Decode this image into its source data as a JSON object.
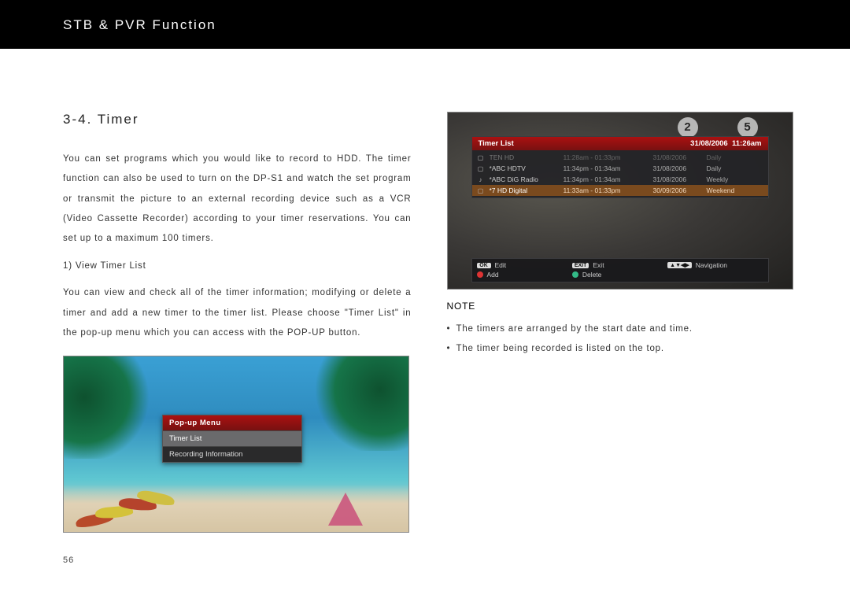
{
  "header": {
    "title": "STB & PVR Function"
  },
  "section": {
    "number": "3-4. Timer"
  },
  "left": {
    "p1": "You can set programs which you would like to record to HDD. The timer function can also be used to turn on the DP-S1 and watch the set program or transmit the picture to an external recording device such as a VCR (Video Cassette Recorder) according to your timer reservations. You can set up to a maximum 100 timers.",
    "sub1": "1) View Timer List",
    "p2": "You can view and check all of the timer information; modifying or delete a timer and add a new timer to the timer list. Please choose \"Timer List\" in the pop-up menu which you can access with the POP-UP button."
  },
  "popup": {
    "title": "Pop-up Menu",
    "items": [
      "Timer List",
      "Recording Information"
    ]
  },
  "timer": {
    "title": "Timer List",
    "datetime_date": "31/08/2006",
    "datetime_time": "11:26am",
    "rows": [
      {
        "icon": "tv",
        "name": "TEN HD",
        "time": "11:28am - 01:33pm",
        "date": "31/08/2006",
        "repeat": "Daily"
      },
      {
        "icon": "tv",
        "name": "*ABC HDTV",
        "time": "11:34pm - 01:34am",
        "date": "31/08/2006",
        "repeat": "Daily"
      },
      {
        "icon": "radio",
        "name": "*ABC DiG Radio",
        "time": "11:34pm - 01:34am",
        "date": "31/08/2006",
        "repeat": "Weekly"
      },
      {
        "icon": "tv",
        "name": "*7 HD Digital",
        "time": "11:33am - 01:33pm",
        "date": "30/09/2006",
        "repeat": "Weekend"
      }
    ],
    "hints": {
      "ok": "Edit",
      "exit": "Exit",
      "nav": "Navigation",
      "add": "Add",
      "del": "Delete",
      "ok_key": "OK",
      "exit_key": "EXIT",
      "nav_key": "▲▼◀▶"
    }
  },
  "race": {
    "n1": "2",
    "n2": "5"
  },
  "note": {
    "title": "NOTE",
    "b1": "The timers are arranged by the start date and time.",
    "b2": "The timer being recorded is listed on the top."
  },
  "page_number": "56"
}
